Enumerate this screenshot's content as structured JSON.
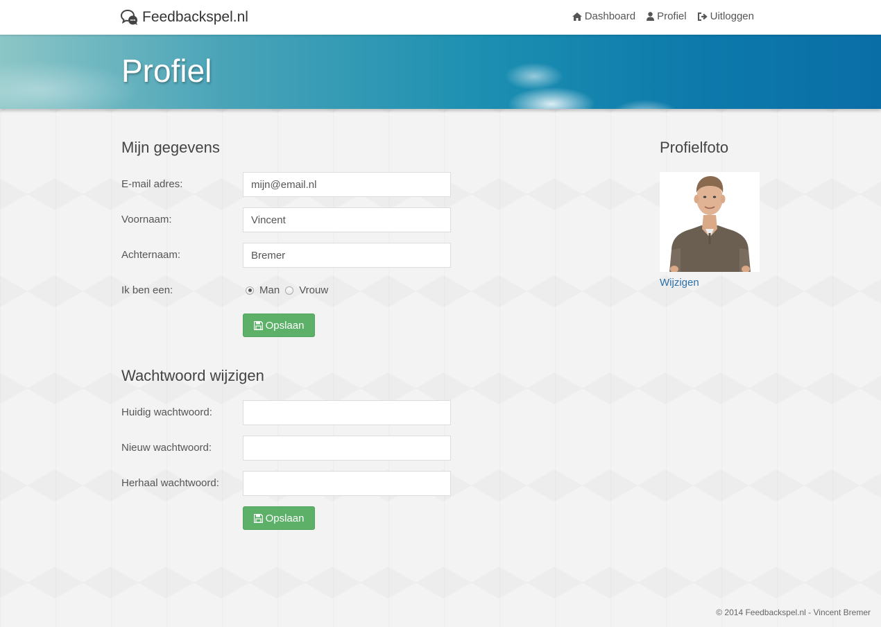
{
  "brand": {
    "name": "Feedbackspel.nl",
    "icon": "chat-bubbles-icon"
  },
  "nav": [
    {
      "label": "Dashboard",
      "icon": "home-icon"
    },
    {
      "label": "Profiel",
      "icon": "user-icon"
    },
    {
      "label": "Uitloggen",
      "icon": "sign-out-icon"
    }
  ],
  "hero": {
    "title": "Profiel"
  },
  "details": {
    "heading": "Mijn gegevens",
    "email_label": "E-mail adres:",
    "email_value": "mijn@email.nl",
    "firstname_label": "Voornaam:",
    "firstname_value": "Vincent",
    "lastname_label": "Achternaam:",
    "lastname_value": "Bremer",
    "gender_label": "Ik ben een:",
    "gender_options": [
      "Man",
      "Vrouw"
    ],
    "gender_selected": "Man",
    "save_label": "Opslaan"
  },
  "password": {
    "heading": "Wachtwoord wijzigen",
    "current_label": "Huidig wachtwoord:",
    "new_label": "Nieuw wachtwoord:",
    "repeat_label": "Herhaal wachtwoord:",
    "save_label": "Opslaan"
  },
  "photo": {
    "heading": "Profielfoto",
    "change_label": "Wijzigen"
  },
  "footer": {
    "text": "© 2014 Feedbackspel.nl - Vincent Bremer"
  },
  "colors": {
    "accent_green": "#5cb068",
    "link_blue": "#2a6fa8"
  }
}
